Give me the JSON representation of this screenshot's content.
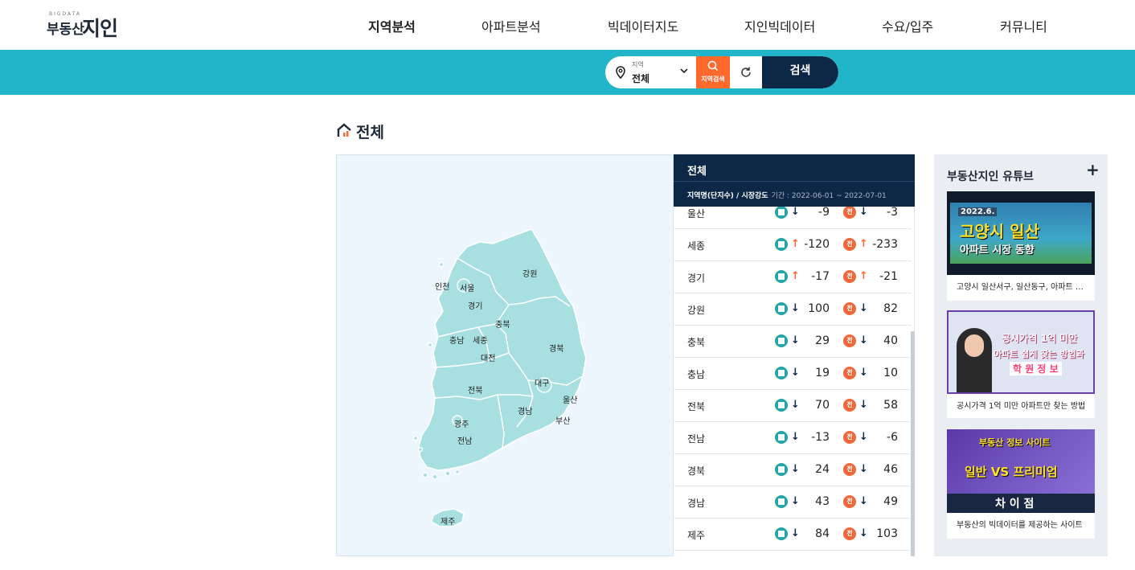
{
  "logo": {
    "sub": "BIGDATA",
    "brand": "부동산",
    "brand2": "지인"
  },
  "nav": [
    {
      "label": "지역분석",
      "active": true
    },
    {
      "label": "아파트분석"
    },
    {
      "label": "빅데이터지도"
    },
    {
      "label": "지인빅데이터"
    },
    {
      "label": "수요/입주"
    },
    {
      "label": "커뮤니티"
    }
  ],
  "search": {
    "region_label": "지역",
    "region_value": "전체",
    "search_button": "지역검색",
    "submit_button": "검색"
  },
  "page_title": "전체",
  "map": {
    "labels": [
      "강원",
      "인천",
      "서울",
      "경기",
      "충북",
      "충남",
      "세종",
      "대전",
      "경북",
      "대구",
      "전북",
      "울산",
      "경남",
      "광주",
      "부산",
      "전남",
      "제주"
    ],
    "colors": {
      "land": "#a8dfe0",
      "border": "#ffffff"
    }
  },
  "table": {
    "title": "전체",
    "subtitle": "지역명(단지수) / 시장강도",
    "period": "기간 : 2022-06-01 ~ 2022-07-01",
    "badge_jeon": "전",
    "rows": [
      {
        "name": "울산",
        "trade_dir": "down",
        "trade": "-9",
        "jeon_dir": "down",
        "jeon": "-3"
      },
      {
        "name": "세종",
        "trade_dir": "up",
        "trade": "-120",
        "jeon_dir": "up",
        "jeon": "-233"
      },
      {
        "name": "경기",
        "trade_dir": "up",
        "trade": "-17",
        "jeon_dir": "up",
        "jeon": "-21"
      },
      {
        "name": "강원",
        "trade_dir": "down",
        "trade": "100",
        "jeon_dir": "down",
        "jeon": "82"
      },
      {
        "name": "충북",
        "trade_dir": "down",
        "trade": "29",
        "jeon_dir": "down",
        "jeon": "40"
      },
      {
        "name": "충남",
        "trade_dir": "down",
        "trade": "19",
        "jeon_dir": "down",
        "jeon": "10"
      },
      {
        "name": "전북",
        "trade_dir": "down",
        "trade": "70",
        "jeon_dir": "down",
        "jeon": "58"
      },
      {
        "name": "전남",
        "trade_dir": "down",
        "trade": "-13",
        "jeon_dir": "down",
        "jeon": "-6"
      },
      {
        "name": "경북",
        "trade_dir": "down",
        "trade": "24",
        "jeon_dir": "down",
        "jeon": "46"
      },
      {
        "name": "경남",
        "trade_dir": "down",
        "trade": "43",
        "jeon_dir": "down",
        "jeon": "49"
      },
      {
        "name": "제주",
        "trade_dir": "down",
        "trade": "84",
        "jeon_dir": "down",
        "jeon": "103"
      }
    ]
  },
  "youtube": {
    "title": "부동산지인 유튜브",
    "plus": "+",
    "cards": [
      {
        "caption": "고양시 일산서구, 일산동구, 아파트 시장 동향",
        "thumb_tag": "2022.6.",
        "thumb_line1": "고양시 일산",
        "thumb_line2": "아파트 시장 동향"
      },
      {
        "caption": "공시가격 1억 미만 아파트만 찾는 방법",
        "thumb_line1": "공시가격 1억 미만",
        "thumb_line2": "아파트 쉽게 찾는 방법과",
        "thumb_line3": "학 원 정 보"
      },
      {
        "caption": "부동산의 빅데이터를 제공하는 사이트",
        "thumb_line1": "부동산 정보 사이트",
        "thumb_line2": "일반 VS 프리미엄",
        "thumb_line3": "차 이 점"
      }
    ]
  },
  "colors": {
    "teal": "#22b4c9",
    "navy": "#0d2847",
    "orange": "#ff6a2c"
  }
}
